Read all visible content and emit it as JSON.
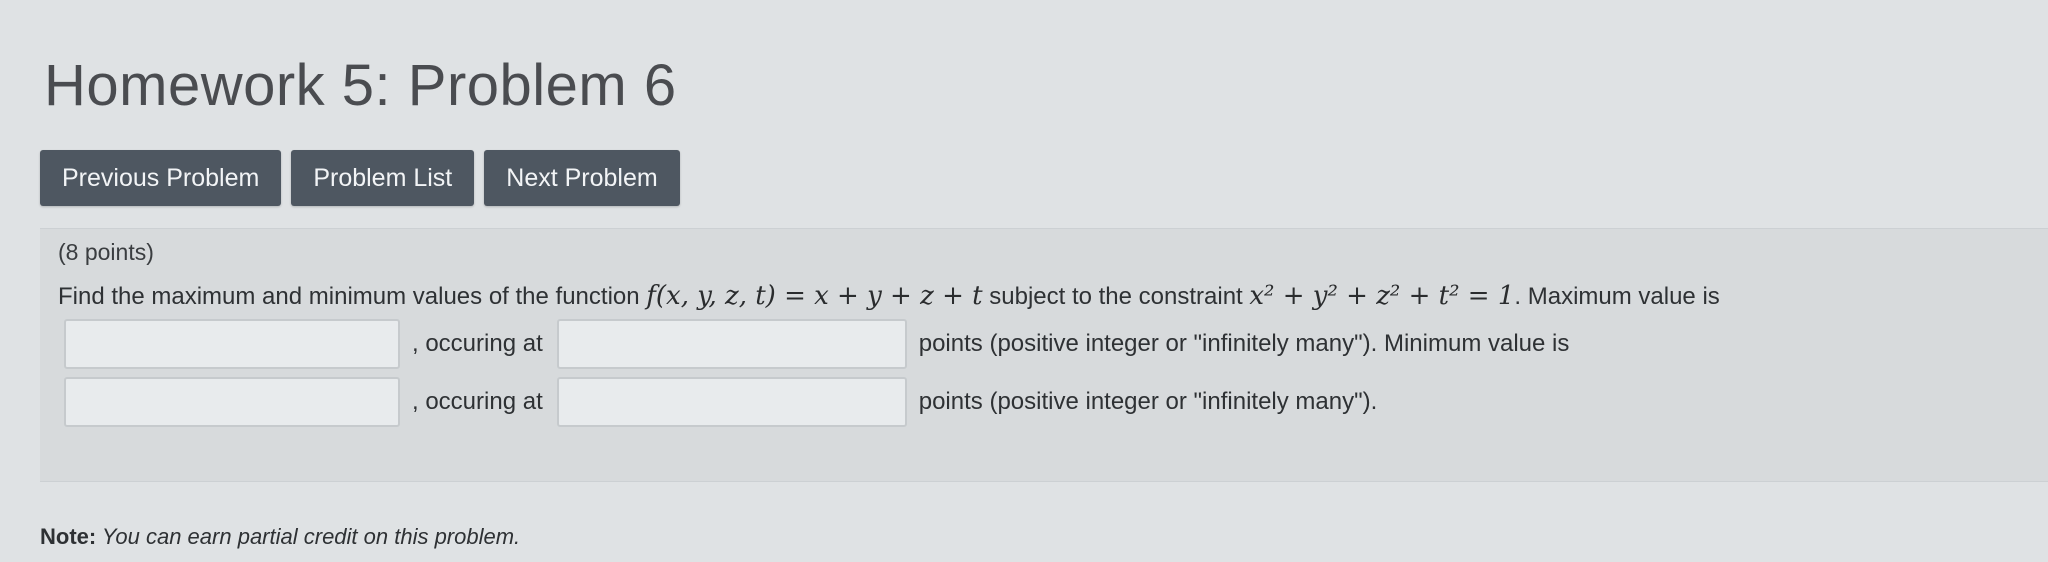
{
  "header": {
    "title": "Homework 5: Problem 6"
  },
  "nav": {
    "previous_label": "Previous Problem",
    "list_label": "Problem List",
    "next_label": "Next Problem"
  },
  "problem": {
    "points": "(8 points)",
    "intro": "Find the maximum and minimum values of the function ",
    "function_math": "f(x, y, z, t) = x + y + z + t",
    "constraint_text": " subject to the constraint ",
    "constraint_math": "x² + y² + z² + t² = 1",
    "max_text": ". Maximum value is",
    "occuring_label_1": ", occuring at",
    "occuring_label_2": ", occuring at",
    "points_hint_1": "points (positive integer or \"infinitely many\"). Minimum value is",
    "points_hint_2": "points (positive integer or \"infinitely many\").",
    "max_value_input": "",
    "max_count_input": "",
    "min_value_input": "",
    "min_count_input": ""
  },
  "note": {
    "label": "Note:",
    "text": " You can earn partial credit on this problem."
  },
  "colors": {
    "button_bg": "#4e5761",
    "button_text": "#f2f4f6",
    "page_bg": "#dfe2e4"
  }
}
